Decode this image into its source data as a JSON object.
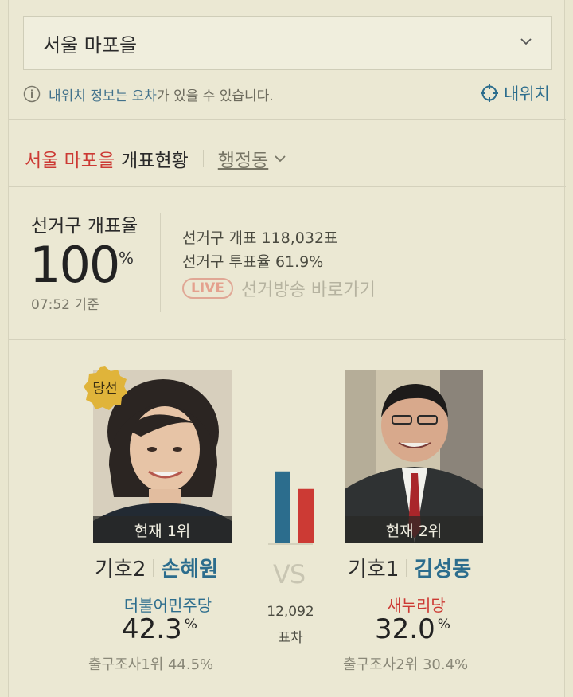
{
  "region": {
    "selected": "서울 마포을"
  },
  "notice": {
    "highlight1": "내위치 정보는 오차",
    "rest": "가 있을 수 있습니다."
  },
  "my_location": {
    "label": "내위치"
  },
  "title": {
    "region": "서울 마포을",
    "suffix": "개표현황",
    "dong_label": "행정동"
  },
  "counting": {
    "label": "선거구 개표율",
    "rate": "100",
    "rate_unit": "%",
    "time": "07:52 기준",
    "votes_line": "선거구 개표  118,032표",
    "turnout_line": "선거구 투표율  61.9%",
    "live_badge": "LIVE",
    "live_text": "선거방송 바로가기"
  },
  "candidates": [
    {
      "rank_label": "현재 1위",
      "winner_badge": "당선",
      "number": "기호2",
      "name": "손혜원",
      "party": "더불어민주당",
      "party_color": "#2c6d8d",
      "pct": "42.3",
      "pct_unit": "%",
      "exit_poll": "출구조사1위 44.5%"
    },
    {
      "rank_label": "현재 2위",
      "number": "기호1",
      "name": "김성동",
      "party": "새누리당",
      "party_color": "#cc3a34",
      "pct": "32.0",
      "pct_unit": "%",
      "exit_poll": "출구조사2위 30.4%"
    }
  ],
  "versus": {
    "vs": "VS",
    "gap": "12,092",
    "gap_label": "표차"
  },
  "chart_data": {
    "type": "bar",
    "categories": [
      "손혜원",
      "김성동"
    ],
    "values": [
      42.3,
      32.0
    ],
    "colors": [
      "#2c6d8d",
      "#cc3a34"
    ]
  }
}
